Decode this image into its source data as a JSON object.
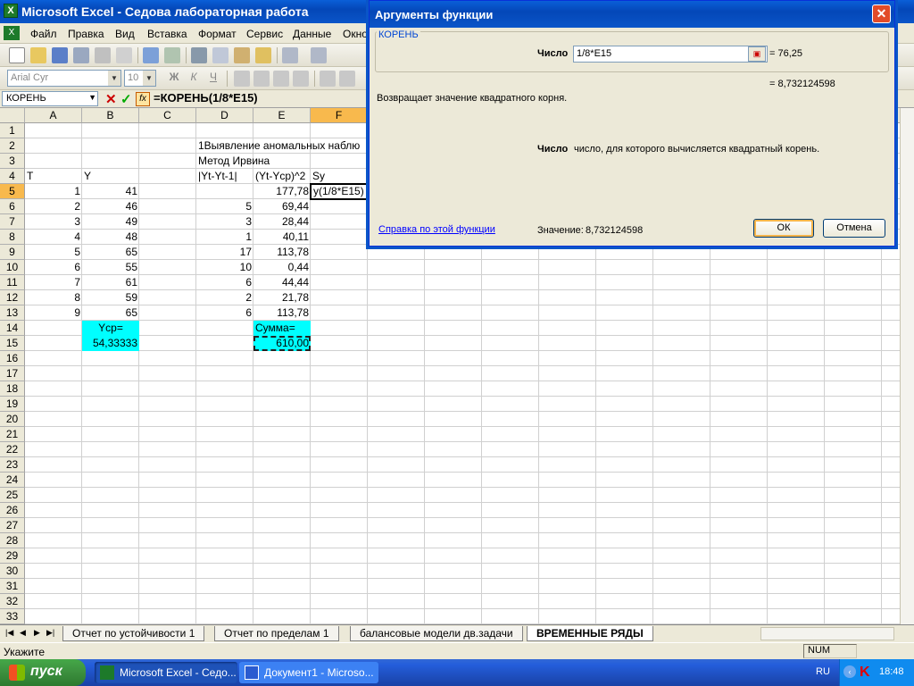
{
  "window": {
    "title": "Microsoft Excel - Седова лабораторная работа",
    "app_icon_text": "X"
  },
  "menu": [
    "Файл",
    "Правка",
    "Вид",
    "Вставка",
    "Формат",
    "Сервис",
    "Данные",
    "Окно"
  ],
  "format_toolbar": {
    "font": "Arial Cyr",
    "size": "10"
  },
  "formula_bar": {
    "name_box": "КОРЕНЬ",
    "cancel": "✕",
    "enter": "✓",
    "fx": "fx",
    "formula": "=КОРЕНЬ(1/8*E15)"
  },
  "columns": [
    "A",
    "B",
    "C",
    "D",
    "E",
    "F"
  ],
  "rows": [
    "1",
    "2",
    "3",
    "4",
    "5",
    "6",
    "7",
    "8",
    "9",
    "10",
    "11",
    "12",
    "13",
    "14",
    "15",
    "16",
    "17",
    "18",
    "19",
    "20",
    "21",
    "22",
    "23",
    "24",
    "25",
    "26",
    "27",
    "28",
    "29",
    "30",
    "31",
    "32",
    "33"
  ],
  "cells": {
    "d2": "1Выявление аномальных наблю",
    "d3": "Метод Ирвина",
    "a4": "T",
    "b4": "Y",
    "d4": "|Yt-Yt-1|",
    "e4": "(Yt-Ycp)^2",
    "f4": "Sy",
    "a_col": [
      "1",
      "2",
      "3",
      "4",
      "5",
      "6",
      "7",
      "8",
      "9"
    ],
    "b_col": [
      "41",
      "46",
      "49",
      "48",
      "65",
      "55",
      "61",
      "59",
      "65"
    ],
    "d_col": [
      "",
      "5",
      "3",
      "1",
      "17",
      "10",
      "6",
      "2",
      "6"
    ],
    "e_col": [
      "177,78",
      "69,44",
      "28,44",
      "40,11",
      "113,78",
      "0,44",
      "44,44",
      "21,78",
      "113,78"
    ],
    "f5": "у(1/8*E15)",
    "b14": "Ycp=",
    "b15": "54,33333",
    "e14": "Сумма=",
    "e15": "610,00"
  },
  "sheet_tabs": [
    "Отчет по устойчивости 1",
    "Отчет по пределам 1",
    "балансовые модели дв.задачи",
    "ВРЕМЕННЫЕ РЯДЫ"
  ],
  "status": {
    "mode": "Укажите",
    "num": "NUM"
  },
  "taskbar": {
    "start": "пуск",
    "tasks": [
      "Microsoft Excel - Седо...",
      "Документ1 - Microso..."
    ],
    "lang": "RU",
    "clock": "18:48"
  },
  "dialog": {
    "title": "Аргументы функции",
    "function_name": "КОРЕНЬ",
    "arg_label": "Число",
    "arg_value": "1/8*E15",
    "arg_result": "= 76,25",
    "formula_result": "= 8,732124598",
    "description": "Возвращает значение квадратного корня.",
    "arg_help_label": "Число",
    "arg_help_text": "число, для которого вычисляется квадратный корень.",
    "help_link": "Справка по этой функции",
    "value_label": "Значение:",
    "value": "8,732124598",
    "ok": "ОК",
    "cancel": "Отмена"
  }
}
